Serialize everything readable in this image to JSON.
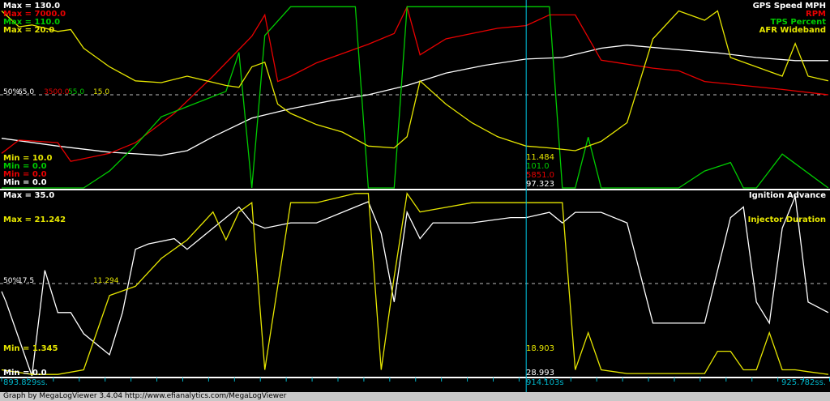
{
  "colors": {
    "white": "#ffffff",
    "red": "#e80000",
    "green": "#00cc00",
    "yellow": "#e6e600",
    "cursor": "#00c8e6",
    "time": "#00b4c8",
    "divider": "#ffffff"
  },
  "top_panel": {
    "max_labels": [
      "Max = 130.0",
      "Max = 7000.0",
      "Max = 110.0",
      "Max = 20.0"
    ],
    "min_labels": [
      "Min = 10.0",
      "Min = 0.0",
      "Min = 0.0",
      "Min = 0.0"
    ],
    "mid_pct": "50%",
    "mid_values": [
      "65.0",
      "3500.0",
      "55.0",
      "15.0"
    ],
    "channels": [
      "GPS Speed MPH",
      "RPM",
      "TPS Percent",
      "AFR Wideband"
    ],
    "cursor_values": [
      "11.484",
      "101.0",
      "5851.0",
      "97.323"
    ]
  },
  "bottom_panel": {
    "max_labels": [
      "Max = 35.0",
      "Max = 21.242"
    ],
    "min_labels": [
      "Min = 1.345",
      "Min = 0.0"
    ],
    "mid_pct": "50%",
    "mid_values": [
      "17.5",
      "11.294"
    ],
    "channels": [
      "Ignition Advance",
      "Injector Duration"
    ],
    "cursor_values": [
      "18.903",
      "28.993"
    ]
  },
  "time_axis": {
    "start": "893.829ss.",
    "cursor": "914.103s",
    "end": "925.782ss."
  },
  "footer": {
    "text": "Graph by MegaLogViewer 3.4.04 http://www.efianalytics.com/MegaLogViewer"
  },
  "chart_data": [
    {
      "type": "line",
      "title": "",
      "x_unit": "s",
      "xlim": [
        893.829,
        925.782
      ],
      "series": [
        {
          "name": "GPS Speed MPH",
          "color": "#ffffff",
          "ylim": [
            10,
            130
          ],
          "x": [
            893.83,
            896.0,
            898.0,
            900.0,
            901.0,
            902.0,
            903.5,
            905.0,
            906.5,
            908.0,
            909.5,
            911.0,
            912.5,
            914.1,
            915.5,
            917.0,
            918.0,
            920.0,
            921.5,
            923.0,
            924.5,
            925.78
          ],
          "y": [
            42,
            37,
            33,
            31,
            34,
            43,
            55,
            61,
            66,
            70,
            76,
            84,
            89,
            93,
            94,
            100,
            102,
            99,
            97,
            94,
            92,
            92
          ]
        },
        {
          "name": "RPM",
          "color": "#e80000",
          "ylim": [
            0,
            7000
          ],
          "x": [
            893.83,
            894.5,
            896.0,
            896.5,
            898.0,
            899.0,
            900.5,
            902.0,
            903.5,
            904.0,
            904.5,
            905.0,
            906.0,
            908.0,
            909.0,
            909.5,
            910.0,
            911.0,
            912.0,
            913.0,
            914.1,
            915.0,
            916.0,
            917.0,
            919.0,
            920.0,
            921.0,
            922.0,
            924.0,
            925.78
          ],
          "y": [
            1300,
            1800,
            1700,
            1000,
            1300,
            1700,
            2800,
            4200,
            5700,
            6500,
            4000,
            4200,
            4700,
            5400,
            5800,
            6800,
            5000,
            5600,
            5800,
            6000,
            6100,
            6500,
            6500,
            4800,
            4500,
            4400,
            4000,
            3900,
            3700,
            3500
          ]
        },
        {
          "name": "TPS Percent",
          "color": "#00cc00",
          "ylim": [
            0,
            110
          ],
          "x": [
            893.83,
            897.0,
            898.0,
            899.0,
            900.0,
            901.0,
            902.5,
            903.0,
            903.5,
            904.0,
            905.0,
            906.0,
            907.5,
            908.0,
            909.0,
            909.5,
            910.5,
            911.0,
            912.5,
            914.1,
            915.0,
            915.5,
            916.0,
            916.5,
            917.0,
            918.0,
            920.0,
            921.0,
            922.0,
            922.5,
            923.0,
            924.0,
            925.78
          ],
          "y": [
            0,
            0,
            10,
            25,
            42,
            48,
            57,
            80,
            0,
            90,
            107,
            107,
            107,
            0,
            0,
            107,
            107,
            107,
            107,
            107,
            107,
            0,
            0,
            30,
            0,
            0,
            0,
            10,
            15,
            0,
            0,
            20,
            0
          ]
        },
        {
          "name": "AFR Wideband",
          "color": "#e6e600",
          "ylim": [
            0,
            20
          ],
          "x": [
            893.83,
            894.5,
            895.0,
            896.0,
            896.5,
            897.0,
            898.0,
            899.0,
            900.0,
            901.0,
            902.5,
            903.0,
            903.5,
            904.0,
            904.5,
            905.0,
            906.0,
            907.0,
            908.0,
            909.0,
            909.5,
            910.0,
            911.0,
            912.0,
            913.0,
            914.1,
            915.0,
            916.0,
            917.0,
            918.0,
            919.0,
            920.0,
            921.0,
            921.5,
            922.0,
            923.0,
            924.0,
            924.5,
            925.0,
            925.78
          ],
          "y": [
            19,
            17.3,
            17.5,
            16.8,
            17.0,
            15.0,
            13.0,
            11.5,
            11.3,
            12.0,
            11.0,
            10.8,
            13.0,
            13.5,
            9.0,
            8.0,
            6.8,
            6.0,
            4.5,
            4.3,
            5.5,
            11.5,
            9.0,
            7.0,
            5.5,
            4.5,
            4.3,
            4.0,
            5.0,
            7.0,
            16.0,
            19.0,
            18.0,
            19.0,
            14.0,
            13.0,
            12.0,
            15.5,
            12.0,
            11.5
          ]
        }
      ]
    },
    {
      "type": "line",
      "title": "",
      "x_unit": "s",
      "xlim": [
        893.829,
        925.782
      ],
      "series": [
        {
          "name": "Ignition Advance",
          "color": "#ffffff",
          "ylim": [
            0,
            35
          ],
          "x": [
            893.83,
            894.0,
            895.0,
            895.5,
            896.0,
            896.5,
            897.0,
            898.0,
            898.5,
            899.0,
            899.5,
            900.5,
            901.0,
            902.0,
            902.5,
            903.0,
            903.5,
            904.0,
            905.0,
            906.0,
            907.5,
            908.0,
            908.5,
            909.0,
            909.5,
            910.0,
            910.5,
            912.0,
            913.5,
            914.1,
            915.0,
            915.5,
            916.0,
            917.0,
            918.0,
            919.0,
            920.0,
            921.0,
            922.0,
            922.5,
            923.0,
            923.5,
            924.0,
            924.5,
            925.0,
            925.78
          ],
          "y": [
            16,
            14,
            0,
            20,
            12,
            12,
            8,
            4,
            12,
            24,
            25,
            26,
            24,
            28,
            30,
            32,
            29,
            28,
            29,
            29,
            32,
            33,
            27,
            14,
            31,
            26,
            29,
            29,
            30,
            30,
            31,
            29,
            31,
            31,
            29,
            10,
            10,
            10,
            30,
            32,
            14,
            10,
            28,
            34,
            14,
            12
          ]
        },
        {
          "name": "Injector Duration",
          "color": "#e6e600",
          "ylim": [
            1.345,
            21.242
          ],
          "x": [
            893.83,
            895.0,
            896.0,
            897.0,
            898.0,
            899.0,
            900.0,
            901.0,
            902.0,
            902.5,
            903.0,
            903.5,
            904.0,
            905.0,
            906.0,
            907.5,
            908.0,
            908.5,
            909.0,
            909.5,
            910.0,
            912.0,
            914.1,
            915.5,
            916.0,
            916.5,
            917.0,
            918.0,
            919.0,
            920.0,
            921.0,
            921.5,
            922.0,
            922.5,
            923.0,
            923.5,
            924.0,
            924.5,
            925.0,
            925.78
          ],
          "y": [
            2,
            1.5,
            1.5,
            2,
            10,
            11,
            14,
            16,
            19,
            16,
            19,
            20,
            2,
            20,
            20,
            21,
            21,
            2,
            12,
            21,
            19,
            20,
            20,
            20,
            2,
            6,
            2,
            1.6,
            1.6,
            1.6,
            1.6,
            4,
            4,
            2,
            2,
            6,
            2,
            2,
            1.8,
            1.5
          ]
        }
      ]
    }
  ]
}
